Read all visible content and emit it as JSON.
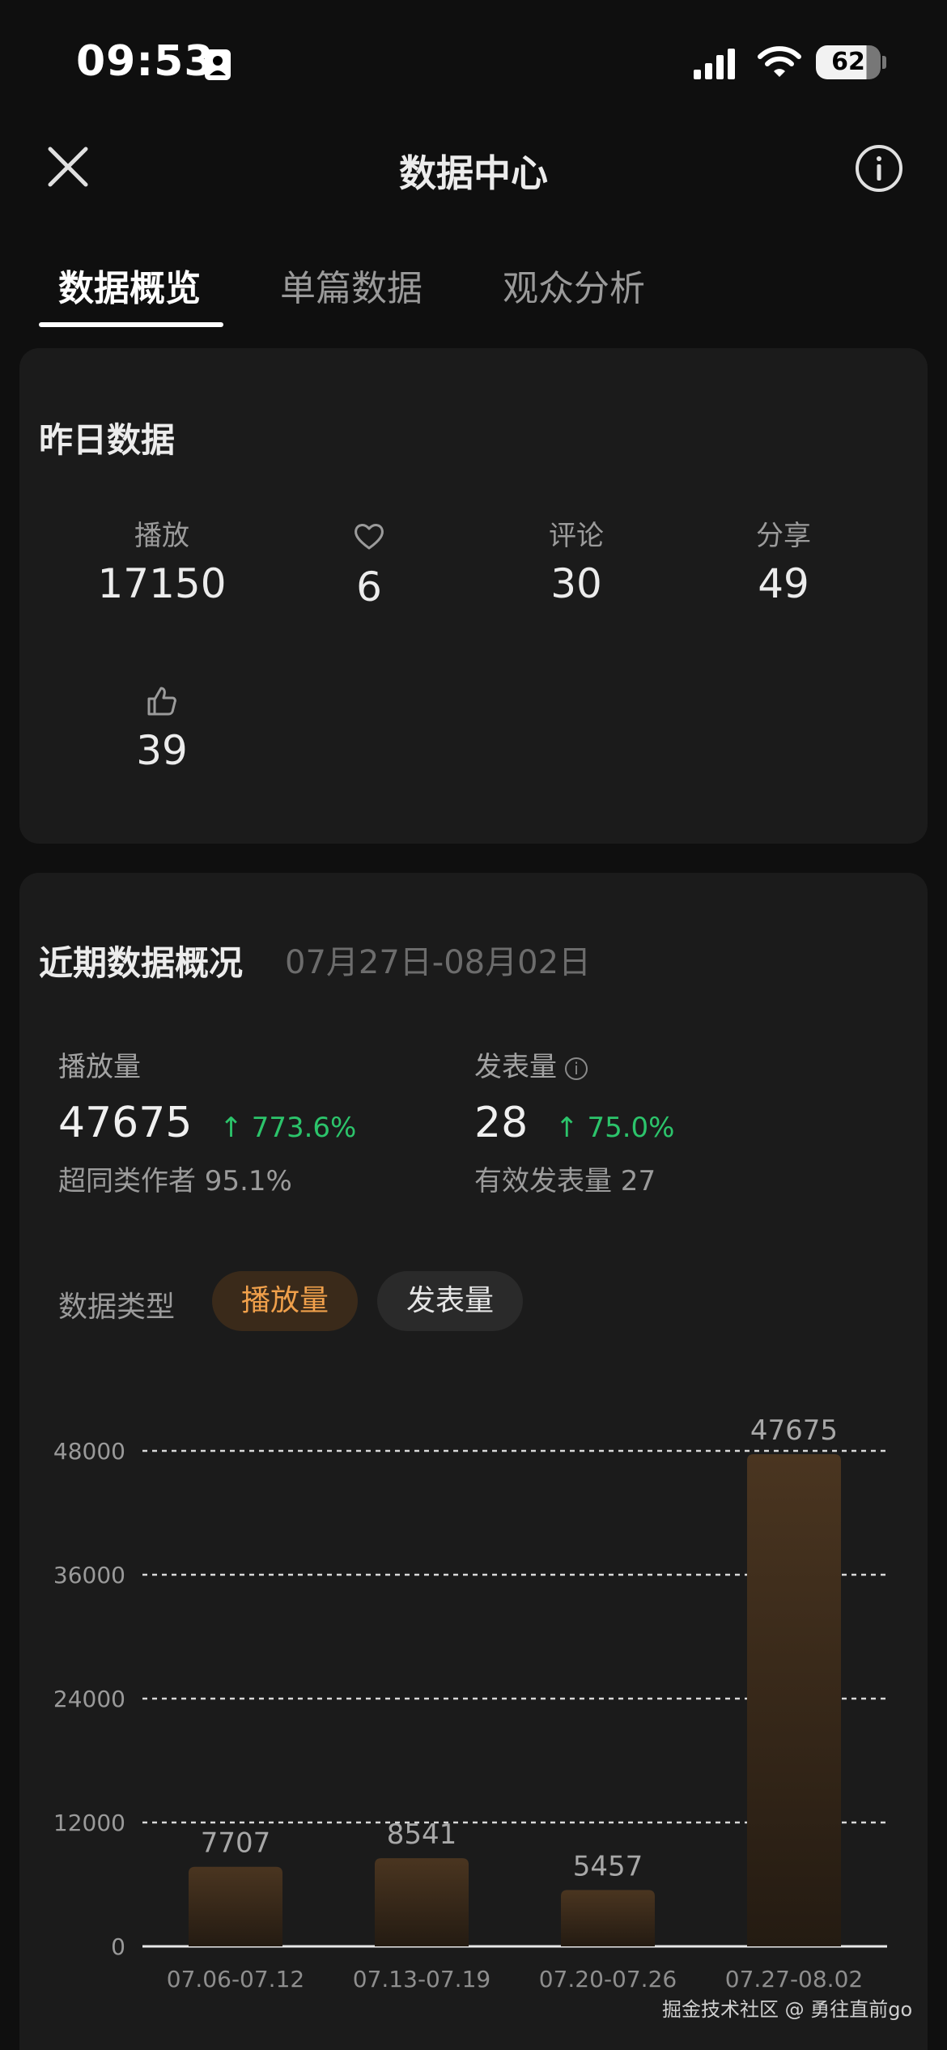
{
  "status_bar": {
    "time": "09:53",
    "battery": "62"
  },
  "header": {
    "title": "数据中心"
  },
  "tabs": [
    {
      "label": "数据概览",
      "active": true
    },
    {
      "label": "单篇数据",
      "active": false
    },
    {
      "label": "观众分析",
      "active": false
    }
  ],
  "yesterday": {
    "title": "昨日数据",
    "metrics": [
      {
        "label": "播放",
        "value": "17150"
      },
      {
        "label": "",
        "icon": "heart-icon",
        "value": "6"
      },
      {
        "label": "评论",
        "value": "30"
      },
      {
        "label": "分享",
        "value": "49"
      },
      {
        "label": "",
        "icon": "thumbs-up-icon",
        "value": "39"
      }
    ]
  },
  "recent": {
    "title": "近期数据概况",
    "range": "07月27日-08月02日",
    "plays": {
      "label": "播放量",
      "value": "47675",
      "change": "↑ 773.6%",
      "sub": "超同类作者 95.1%"
    },
    "posts": {
      "label": "发表量",
      "value": "28",
      "change": "↑ 75.0%",
      "sub": "有效发表量 27"
    },
    "type_label": "数据类型",
    "chips": {
      "plays": "播放量",
      "posts": "发表量"
    }
  },
  "chart_data": {
    "type": "bar",
    "categories": [
      "07.06-07.12",
      "07.13-07.19",
      "07.20-07.26",
      "07.27-08.02"
    ],
    "values": [
      7707,
      8541,
      5457,
      47675
    ],
    "yticks": [
      0,
      12000,
      24000,
      36000,
      48000
    ],
    "ylim": [
      0,
      48000
    ],
    "grid": true
  },
  "watermark": "掘金技术社区 @ 勇往直前go"
}
